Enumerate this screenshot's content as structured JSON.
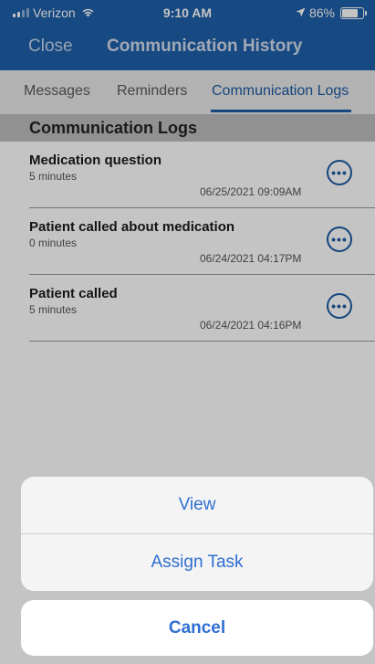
{
  "status_bar": {
    "carrier": "Verizon",
    "time": "9:10 AM",
    "battery": "86%",
    "battery_level": 0.86
  },
  "nav": {
    "close_label": "Close",
    "title": "Communication History"
  },
  "tabs": [
    {
      "label": "Messages",
      "active": false
    },
    {
      "label": "Reminders",
      "active": false
    },
    {
      "label": "Communication Logs",
      "active": true
    }
  ],
  "section": {
    "title": "Communication Logs"
  },
  "logs": [
    {
      "title": "Medication question",
      "duration": "5 minutes",
      "date": "06/25/2021 09:09AM"
    },
    {
      "title": "Patient called about medication",
      "duration": "0 minutes",
      "date": "06/24/2021 04:17PM"
    },
    {
      "title": "Patient called",
      "duration": "5 minutes",
      "date": "06/24/2021 04:16PM"
    }
  ],
  "action_sheet": {
    "view_label": "View",
    "assign_label": "Assign Task",
    "cancel_label": "Cancel"
  },
  "colors": {
    "nav_background": "#1f5fa9",
    "accent": "#1c5ba3",
    "action_text": "#2f6fd1"
  },
  "icons": {
    "more": "ellipsis-circle-icon",
    "wifi": "wifi-icon",
    "location": "location-arrow-icon",
    "battery": "battery-icon",
    "signal": "signal-icon"
  }
}
